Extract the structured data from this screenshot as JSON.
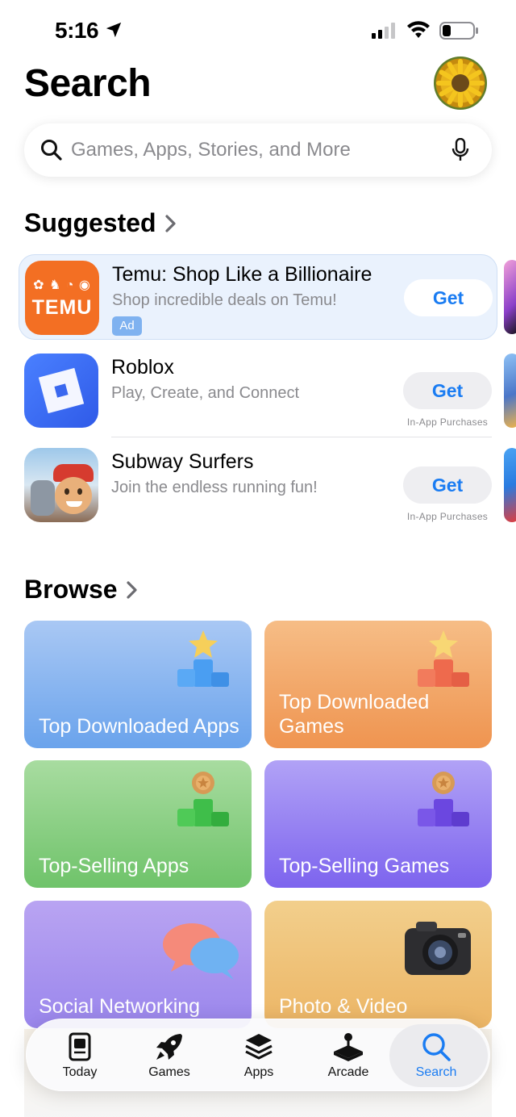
{
  "status_bar": {
    "time": "5:16"
  },
  "header": {
    "title": "Search"
  },
  "search": {
    "placeholder": "Games, Apps, Stories, and More"
  },
  "suggested": {
    "title": "Suggested",
    "apps": [
      {
        "name": "Temu: Shop Like a Billionaire",
        "subtitle": "Shop incredible deals on Temu!",
        "badge": "Ad",
        "get": "Get",
        "icon_text": "TEMU",
        "icon_color": "#f36f23"
      },
      {
        "name": "Roblox",
        "subtitle": "Play, Create, and Connect",
        "get": "Get",
        "purchase_note": "In-App Purchases",
        "icon_color": "#3b6cf1"
      },
      {
        "name": "Subway Surfers",
        "subtitle": "Join the endless running fun!",
        "get": "Get",
        "purchase_note": "In-App Purchases"
      }
    ]
  },
  "browse": {
    "title": "Browse",
    "tiles": [
      {
        "label": "Top Downloaded Apps",
        "icon": "podium-star-icon"
      },
      {
        "label": "Top Downloaded Games",
        "icon": "podium-star-icon"
      },
      {
        "label": "Top-Selling Apps",
        "icon": "podium-coin-icon"
      },
      {
        "label": "Top-Selling Games",
        "icon": "podium-coin-icon"
      },
      {
        "label": "Social Networking",
        "icon": "chat-bubbles-icon"
      },
      {
        "label": "Photo & Video",
        "icon": "camera-icon"
      }
    ]
  },
  "tab_bar": {
    "tabs": [
      {
        "label": "Today",
        "icon": "today-icon"
      },
      {
        "label": "Games",
        "icon": "rocket-icon"
      },
      {
        "label": "Apps",
        "icon": "layers-icon"
      },
      {
        "label": "Arcade",
        "icon": "joystick-icon"
      },
      {
        "label": "Search",
        "icon": "search-icon",
        "active": true
      }
    ]
  },
  "colors": {
    "accent": "#1a7cf2",
    "secondary_text": "#8a8a8e"
  }
}
